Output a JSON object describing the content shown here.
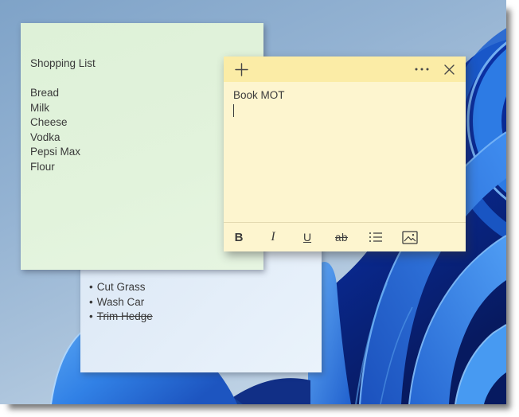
{
  "wallpaper": {
    "description": "Windows 11 bloom over blue sky gradient",
    "colors": {
      "sky_top": "#7fa3c8",
      "sky_bottom": "#cfdeed",
      "bloom_dark": "#071a60",
      "bloom_bright": "#2d7be4"
    }
  },
  "notes": {
    "green": {
      "color": "#e2f3dc",
      "title": "Shopping List",
      "items": [
        "Bread",
        "Milk",
        "Cheese",
        "Vodka",
        "Pepsi Max",
        "Flour"
      ]
    },
    "yellow": {
      "header_color": "#fbeca6",
      "body_color": "#fdf5cf",
      "header_icons": [
        "plus-icon",
        "ellipsis-icon",
        "close-icon"
      ],
      "body_text": "Book MOT",
      "caret_visible": true,
      "toolbar": {
        "bold": "B",
        "italic": "I",
        "underline": "U",
        "strikethrough": "ab",
        "icons": [
          "bullet-list-icon",
          "image-icon"
        ]
      }
    },
    "blue": {
      "color": "#e4eef9",
      "bullet": "•",
      "items": [
        {
          "text": "Cut Grass",
          "done": false
        },
        {
          "text": "Wash Car",
          "done": false
        },
        {
          "text": "Trim Hedge",
          "done": true
        }
      ]
    }
  }
}
